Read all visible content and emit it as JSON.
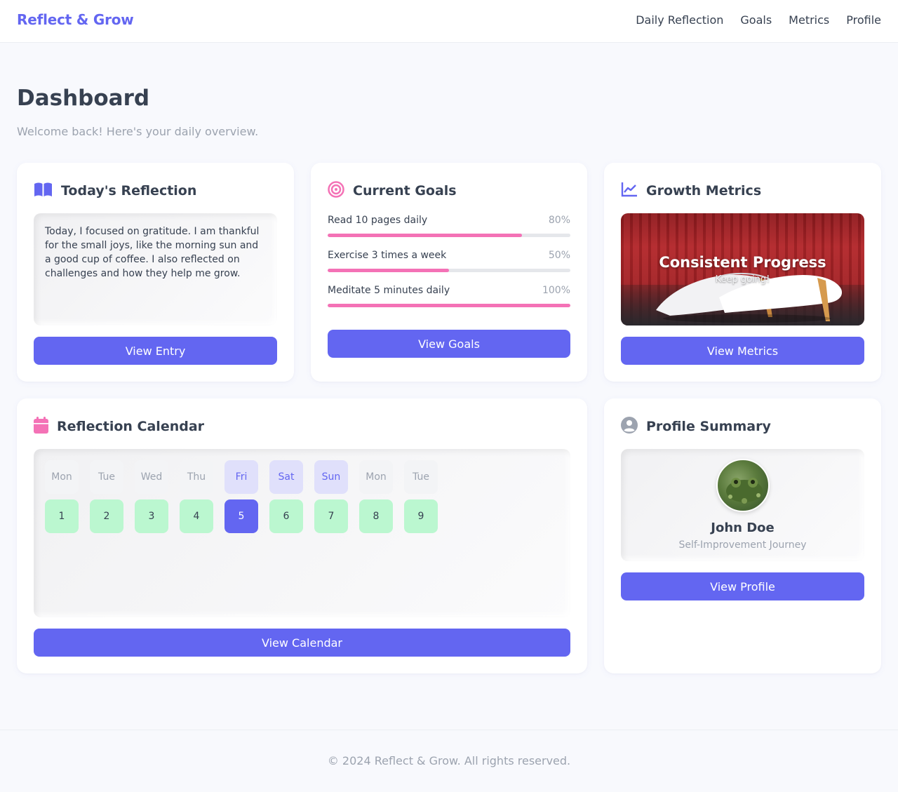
{
  "app": {
    "brand": "Reflect & Grow"
  },
  "nav": [
    {
      "label": "Daily Reflection"
    },
    {
      "label": "Goals"
    },
    {
      "label": "Metrics"
    },
    {
      "label": "Profile"
    }
  ],
  "page": {
    "title": "Dashboard",
    "subtitle": "Welcome back! Here's your daily overview."
  },
  "reflection": {
    "title": "Today's Reflection",
    "icon": "book-open-icon",
    "text": "Today, I focused on gratitude. I am thankful for the small joys, like the morning sun and a good cup of coffee. I also reflected on challenges and how they help me grow.",
    "button": "View Entry"
  },
  "goals": {
    "title": "Current Goals",
    "icon": "target-icon",
    "items": [
      {
        "label": "Read 10 pages daily",
        "percent_text": "80%",
        "progress": 0.8
      },
      {
        "label": "Exercise 3 times a week",
        "percent_text": "50%",
        "progress": 0.5
      },
      {
        "label": "Meditate 5 minutes daily",
        "percent_text": "100%",
        "progress": 1.0
      }
    ],
    "button": "View Goals"
  },
  "metrics": {
    "title": "Growth Metrics",
    "icon": "line-chart-icon",
    "overlay_title": "Consistent Progress",
    "overlay_subtitle": "Keep going!",
    "button": "View Metrics"
  },
  "calendar": {
    "title": "Reflection Calendar",
    "icon": "calendar-icon",
    "day_names": [
      "Mon",
      "Tue",
      "Wed",
      "Thu",
      "Fri",
      "Sat",
      "Sun",
      "Mon",
      "Tue"
    ],
    "days": [
      "1",
      "2",
      "3",
      "4",
      "5",
      "6",
      "7",
      "8",
      "9"
    ],
    "button": "View Calendar"
  },
  "profile": {
    "title": "Profile Summary",
    "icon": "user-circle-icon",
    "name": "John Doe",
    "subtitle": "Self-Improvement Journey",
    "button": "View Profile"
  },
  "footer": {
    "text": "© 2024 Reflect & Grow. All rights reserved."
  },
  "colors": {
    "accent": "#6366f1",
    "pink": "#f472b6",
    "calendar_day": "#bbf7d0",
    "weekend_label": "#e0e0fb"
  }
}
